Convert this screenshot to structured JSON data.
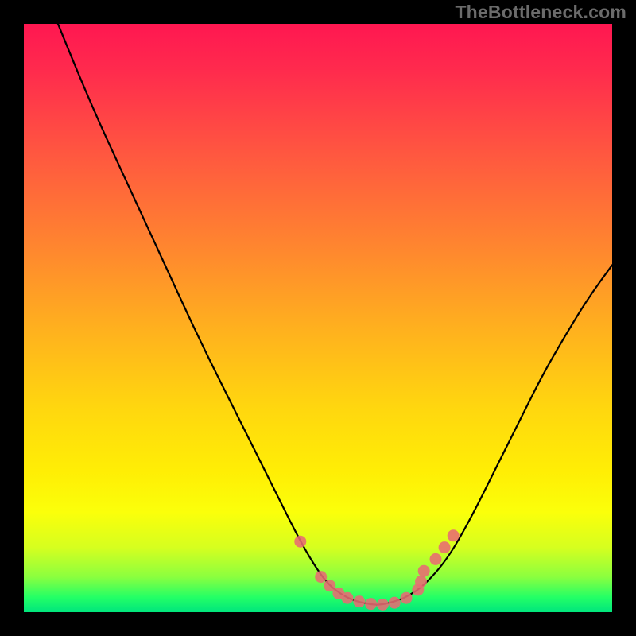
{
  "watermark": "TheBottleneck.com",
  "colors": {
    "background": "#000000",
    "curve": "#000000",
    "marker": "#e86b73",
    "gradient_top": "#ff1751",
    "gradient_bottom": "#00e57d"
  },
  "chart_data": {
    "type": "line",
    "title": "",
    "xlabel": "",
    "ylabel": "",
    "xlim": [
      0,
      100
    ],
    "ylim": [
      0,
      100
    ],
    "x": [
      0,
      3,
      7,
      12,
      18,
      24,
      30,
      36,
      42,
      47,
      50,
      52,
      54,
      56,
      58,
      60,
      62,
      65,
      68,
      72,
      76,
      80,
      84,
      88,
      92,
      96,
      100
    ],
    "values": [
      115,
      107,
      97,
      85,
      72,
      59,
      46,
      34,
      22,
      12,
      7,
      4.5,
      3,
      2,
      1.5,
      1.2,
      1.5,
      2.5,
      4.5,
      9,
      16,
      24,
      32,
      40,
      47,
      53.5,
      59
    ],
    "highlighted_points": {
      "x": [
        47,
        50.5,
        52,
        53.5,
        55,
        57,
        59,
        61,
        63,
        65,
        67,
        67.5,
        68,
        70,
        71.5,
        73
      ],
      "y": [
        12,
        6,
        4.5,
        3.2,
        2.4,
        1.8,
        1.4,
        1.3,
        1.6,
        2.4,
        3.8,
        5.2,
        7,
        9,
        11,
        13
      ]
    }
  }
}
